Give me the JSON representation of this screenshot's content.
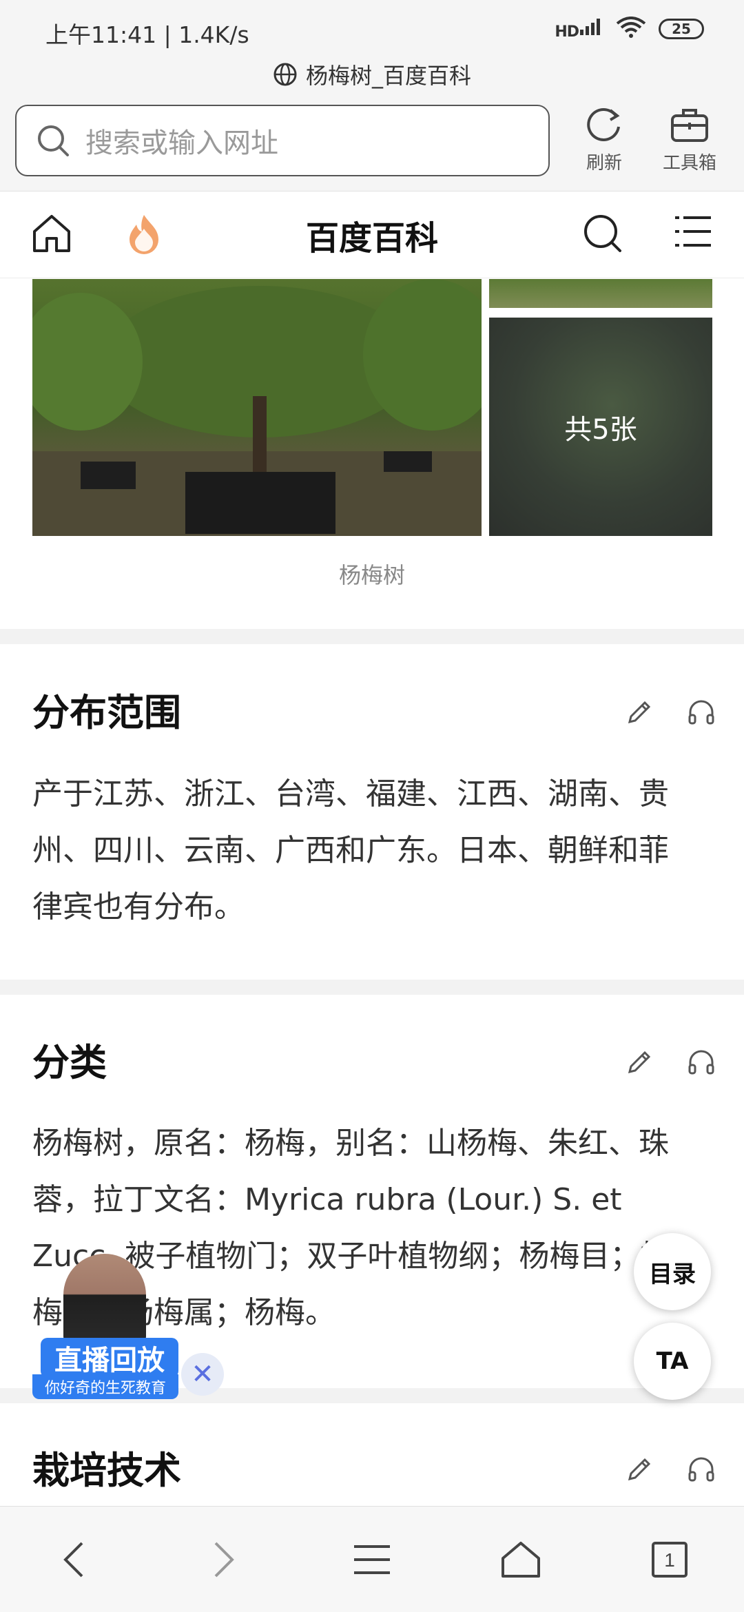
{
  "status_bar": {
    "time": "上午11:41 | 1.4K/s",
    "network": "HD",
    "battery": "25"
  },
  "browser": {
    "page_title": "杨梅树_百度百科",
    "search_placeholder": "搜索或输入网址",
    "refresh_label": "刷新",
    "toolbox_label": "工具箱"
  },
  "site": {
    "title": "百度百科"
  },
  "gallery": {
    "count_label": "共5张",
    "caption": "杨梅树"
  },
  "sections": [
    {
      "title": "分布范围",
      "text": "产于江苏、浙江、台湾、福建、江西、湖南、贵州、四川、云南、广西和广东。日本、朝鲜和菲律宾也有分布。"
    },
    {
      "title": "分类",
      "text": "杨梅树，原名：杨梅，别名：山杨梅、朱红、珠蓉，拉丁文名：Myrica rubra (Lour.) S. et Zucc. 被子植物门；双子叶植物纲；杨梅目；杨梅科；杨梅属；杨梅。"
    },
    {
      "title": "栽培技术"
    }
  ],
  "floating": {
    "toc_label": "目录",
    "ta_label": "TA"
  },
  "live": {
    "title": "直播回放",
    "subtitle": "你好奇的生死教育",
    "close": "✕"
  },
  "bottom_nav": {
    "tabs_count": "1"
  },
  "colors": {
    "accent": "#2f7df0",
    "flame": "#f07a3a"
  }
}
